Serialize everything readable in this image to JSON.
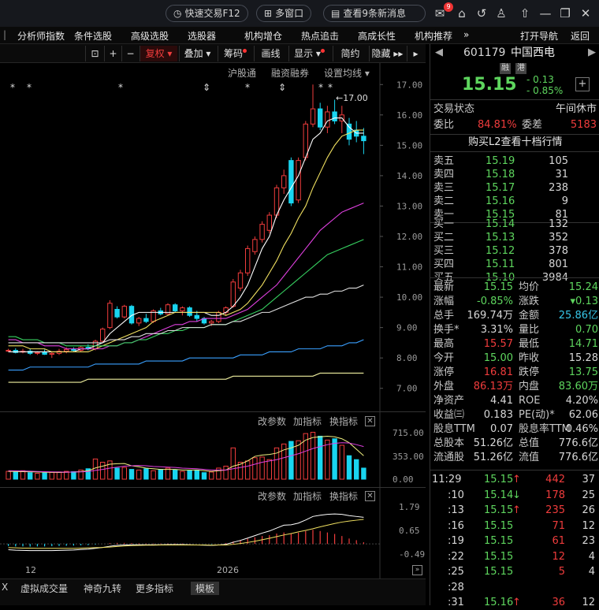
{
  "topbar": {
    "quick_trade": "快速交易F12",
    "multi_window": "多窗口",
    "news": "查看9条新消息",
    "unread": "9"
  },
  "menu": [
    "分析师指数",
    "条件选股",
    "高级选股",
    "选股器",
    "机构增仓",
    "热点追击",
    "高成长性",
    "机构推荐"
  ],
  "menu_more": "»",
  "menu_right": [
    "打开导航",
    "返回"
  ],
  "toolbar": {
    "fuquan": "复权",
    "diejia": "叠加",
    "chouma": "筹码",
    "huaxian": "画线",
    "xianshi": "显示",
    "jianyue": "简约",
    "yincang": "隐藏"
  },
  "subbar": [
    "沪股通",
    "融资融券",
    "设置均线"
  ],
  "price_axis": [
    "17.00",
    "16.00",
    "15.00",
    "14.00",
    "13.00",
    "12.00",
    "11.00",
    "10.00",
    "9.00",
    "8.00",
    "7.00"
  ],
  "high_annotation": "17.00",
  "stars": [
    "*",
    "*",
    "*",
    "⇕",
    "*",
    "⇕",
    "*",
    "*"
  ],
  "vol_pane": {
    "params": "改参数",
    "indicator": "加指标",
    "switch": "换指标",
    "close": "✕",
    "axis": [
      "715.00",
      "353.00",
      "0.00"
    ]
  },
  "macd_pane": {
    "params": "改参数",
    "indicator": "加指标",
    "switch": "换指标",
    "close": "✕",
    "axis": [
      "1.79",
      "0.65",
      "-0.49"
    ]
  },
  "x_axis": [
    "12",
    "2026"
  ],
  "bottom_tabs": [
    "X",
    "虚拟成交量",
    "神奇九转",
    "更多指标",
    "模板"
  ],
  "colors": {
    "up": "#f03c3c",
    "down": "#19d5f0",
    "ma5": "#ffffff",
    "ma10": "#f0e060",
    "ma20": "#e040e0",
    "ma30": "#36d060",
    "ma60": "#e0e0e0",
    "ma120": "#3aa0ff",
    "ma250": "#f0f0a0"
  },
  "quote": {
    "code": "601179",
    "name": "中国西电",
    "tag1": "融",
    "tag2": "港",
    "price": "15.15",
    "change": "- 0.13",
    "pct": "- 0.85%",
    "state_label": "交易状态",
    "state": "午间休市",
    "weibi_label": "委比",
    "weibi": "84.81%",
    "weicha_label": "委差",
    "weicha": "5183",
    "l2": "购买L2查看十档行情",
    "asks": [
      {
        "l": "卖五",
        "p": "15.19",
        "v": "105"
      },
      {
        "l": "卖四",
        "p": "15.18",
        "v": "31"
      },
      {
        "l": "卖三",
        "p": "15.17",
        "v": "238"
      },
      {
        "l": "卖二",
        "p": "15.16",
        "v": "9"
      },
      {
        "l": "卖一",
        "p": "15.15",
        "v": "81"
      }
    ],
    "bids": [
      {
        "l": "买一",
        "p": "15.14",
        "v": "132"
      },
      {
        "l": "买二",
        "p": "15.13",
        "v": "352"
      },
      {
        "l": "买三",
        "p": "15.12",
        "v": "378"
      },
      {
        "l": "买四",
        "p": "15.11",
        "v": "801"
      },
      {
        "l": "买五",
        "p": "15.10",
        "v": "3984"
      }
    ],
    "stats": [
      [
        "最新",
        "15.15",
        "g",
        "均价",
        "15.24",
        "g"
      ],
      [
        "涨幅",
        "-0.85%",
        "g",
        "涨跌",
        "▾0.13",
        "g"
      ],
      [
        "总手",
        "169.74万",
        "w",
        "金额",
        "25.86亿",
        "c"
      ],
      [
        "换手*",
        "3.31%",
        "w",
        "量比",
        "0.70",
        "g"
      ],
      [
        "最高",
        "15.57",
        "r",
        "最低",
        "14.71",
        "g"
      ],
      [
        "今开",
        "15.00",
        "g",
        "昨收",
        "15.28",
        "w"
      ],
      [
        "涨停",
        "16.81",
        "r",
        "跌停",
        "13.75",
        "g"
      ],
      [
        "外盘",
        "86.13万",
        "r",
        "内盘",
        "83.60万",
        "g"
      ],
      [
        "净资产",
        "4.41",
        "w",
        "ROE",
        "4.20%",
        "w"
      ],
      [
        "收益㈢",
        "0.183",
        "w",
        "PE(动)*",
        "62.06",
        "w"
      ],
      [
        "股息TTM",
        "0.07",
        "w",
        "股息率TTM",
        "0.46%",
        "w"
      ],
      [
        "总股本",
        "51.26亿",
        "w",
        "总值",
        "776.6亿",
        "w"
      ],
      [
        "流通股",
        "51.26亿",
        "w",
        "流值",
        "776.6亿",
        "w"
      ]
    ],
    "ticks": [
      [
        "11:29",
        "15.15",
        "↑",
        "442",
        "37"
      ],
      [
        ":10",
        "15.14",
        "↓",
        "178",
        "25"
      ],
      [
        ":13",
        "15.15",
        "↑",
        "235",
        "26"
      ],
      [
        ":16",
        "15.15",
        "",
        "71",
        "12"
      ],
      [
        ":19",
        "15.15",
        "",
        "61",
        "23"
      ],
      [
        ":22",
        "15.15",
        "",
        "12",
        "4"
      ],
      [
        ":25",
        "15.15",
        "",
        "5",
        "4"
      ],
      [
        ":28",
        "",
        "",
        "",
        ""
      ],
      [
        ":31",
        "15.16",
        "↑",
        "36",
        "12"
      ]
    ]
  },
  "chart_data": {
    "type": "candlestick",
    "symbol": "601179",
    "y_ticks": [
      17,
      16,
      15,
      14,
      13,
      12,
      11,
      10,
      9,
      8,
      7
    ],
    "y_range": [
      6.5,
      17.5
    ],
    "candles": [
      [
        8.25,
        8.3,
        8.2,
        8.25
      ],
      [
        8.25,
        8.32,
        8.15,
        8.18
      ],
      [
        8.2,
        8.3,
        8.15,
        8.22
      ],
      [
        8.22,
        8.3,
        8.1,
        8.15
      ],
      [
        8.15,
        8.22,
        8.1,
        8.18
      ],
      [
        8.18,
        8.28,
        8.1,
        8.12
      ],
      [
        8.12,
        8.2,
        8.0,
        8.15
      ],
      [
        8.15,
        8.3,
        8.1,
        8.22
      ],
      [
        8.22,
        8.35,
        8.15,
        8.28
      ],
      [
        8.28,
        8.35,
        8.2,
        8.25
      ],
      [
        8.25,
        8.4,
        8.2,
        8.35
      ],
      [
        8.35,
        8.45,
        8.25,
        8.3
      ],
      [
        8.3,
        8.6,
        8.25,
        8.55
      ],
      [
        8.55,
        9.0,
        8.5,
        8.95
      ],
      [
        9.0,
        9.9,
        8.95,
        9.8
      ],
      [
        9.6,
        9.7,
        9.3,
        9.35
      ],
      [
        9.35,
        9.75,
        9.3,
        9.7
      ],
      [
        9.7,
        9.75,
        9.1,
        9.15
      ],
      [
        9.15,
        9.35,
        9.05,
        9.3
      ],
      [
        9.3,
        9.45,
        9.15,
        9.2
      ],
      [
        9.2,
        9.6,
        9.15,
        9.55
      ],
      [
        9.55,
        9.65,
        9.4,
        9.45
      ],
      [
        9.45,
        9.8,
        9.4,
        9.75
      ],
      [
        9.75,
        9.8,
        9.5,
        9.55
      ],
      [
        9.55,
        9.7,
        9.4,
        9.65
      ],
      [
        9.65,
        9.7,
        9.35,
        9.4
      ],
      [
        9.4,
        9.55,
        9.2,
        9.3
      ],
      [
        9.3,
        9.35,
        9.1,
        9.15
      ],
      [
        9.15,
        9.25,
        9.05,
        9.2
      ],
      [
        9.2,
        9.55,
        9.15,
        9.5
      ],
      [
        9.5,
        9.7,
        9.4,
        9.65
      ],
      [
        9.7,
        10.6,
        9.65,
        10.5
      ],
      [
        10.3,
        10.9,
        10.2,
        10.8
      ],
      [
        10.8,
        11.7,
        10.7,
        11.6
      ],
      [
        11.5,
        12.0,
        11.4,
        11.9
      ],
      [
        11.9,
        12.5,
        11.8,
        12.4
      ],
      [
        12.2,
        12.8,
        12.1,
        12.7
      ],
      [
        12.7,
        13.7,
        12.6,
        13.6
      ],
      [
        13.6,
        14.2,
        13.4,
        14.0
      ],
      [
        14.5,
        14.6,
        13.0,
        13.1
      ],
      [
        13.2,
        14.6,
        13.1,
        14.5
      ],
      [
        14.6,
        15.8,
        14.5,
        15.7
      ],
      [
        15.7,
        17.0,
        15.6,
        16.2
      ],
      [
        16.2,
        16.4,
        15.5,
        15.6
      ],
      [
        15.6,
        16.3,
        15.4,
        16.1
      ],
      [
        16.1,
        16.5,
        15.7,
        15.8
      ],
      [
        15.8,
        16.3,
        15.4,
        16.0
      ],
      [
        15.7,
        15.9,
        15.0,
        15.2
      ],
      [
        15.5,
        15.8,
        15.1,
        15.3
      ],
      [
        15.3,
        15.57,
        14.71,
        15.15
      ]
    ],
    "ma_lines": [
      {
        "name": "MA5",
        "values": [
          8.2,
          8.2,
          8.2,
          8.2,
          8.2,
          8.2,
          8.2,
          8.2,
          8.2,
          8.2,
          8.3,
          8.3,
          8.4,
          8.5,
          8.8,
          9.0,
          9.2,
          9.4,
          9.5,
          9.5,
          9.5,
          9.5,
          9.5,
          9.5,
          9.5,
          9.5,
          9.5,
          9.5,
          9.4,
          9.4,
          9.5,
          9.7,
          10.0,
          10.4,
          11.0,
          11.6,
          12.0,
          12.7,
          13.2,
          13.6,
          14.0,
          14.6,
          15.2,
          15.4,
          15.8,
          15.9,
          15.9,
          15.6,
          15.4,
          15.4
        ]
      },
      {
        "name": "MA10",
        "values": [
          8.4,
          8.4,
          8.4,
          8.3,
          8.3,
          8.3,
          8.2,
          8.2,
          8.2,
          8.2,
          8.2,
          8.2,
          8.3,
          8.4,
          8.5,
          8.6,
          8.7,
          8.8,
          8.9,
          9.0,
          9.2,
          9.3,
          9.4,
          9.5,
          9.5,
          9.5,
          9.5,
          9.5,
          9.5,
          9.5,
          9.4,
          9.5,
          9.6,
          9.8,
          10.1,
          10.4,
          10.8,
          11.2,
          11.7,
          12.1,
          12.6,
          13.0,
          13.6,
          14.1,
          14.6,
          15.0,
          15.3,
          15.4,
          15.5,
          15.5
        ]
      },
      {
        "name": "MA20",
        "values": [
          8.6,
          8.6,
          8.5,
          8.5,
          8.5,
          8.4,
          8.4,
          8.4,
          8.3,
          8.3,
          8.3,
          8.3,
          8.3,
          8.3,
          8.4,
          8.4,
          8.5,
          8.5,
          8.6,
          8.7,
          8.8,
          8.9,
          9.0,
          9.1,
          9.1,
          9.2,
          9.2,
          9.3,
          9.3,
          9.3,
          9.3,
          9.4,
          9.5,
          9.6,
          9.8,
          10.0,
          10.2,
          10.4,
          10.7,
          11.0,
          11.3,
          11.6,
          11.9,
          12.2,
          12.4,
          12.6,
          12.8,
          12.9,
          13.0,
          13.1
        ]
      },
      {
        "name": "MA30",
        "values": [
          8.7,
          8.7,
          8.6,
          8.6,
          8.6,
          8.5,
          8.5,
          8.5,
          8.4,
          8.4,
          8.4,
          8.4,
          8.4,
          8.4,
          8.4,
          8.4,
          8.5,
          8.5,
          8.6,
          8.6,
          8.7,
          8.8,
          8.8,
          8.9,
          8.9,
          9.0,
          9.0,
          9.0,
          9.1,
          9.1,
          9.1,
          9.2,
          9.3,
          9.4,
          9.5,
          9.6,
          9.8,
          10.0,
          10.2,
          10.4,
          10.6,
          10.8,
          11.0,
          11.2,
          11.4,
          11.5,
          11.6,
          11.7,
          11.8,
          11.9
        ]
      },
      {
        "name": "MA60",
        "values": [
          8.5,
          8.5,
          8.5,
          8.5,
          8.5,
          8.5,
          8.5,
          8.5,
          8.5,
          8.5,
          8.5,
          8.5,
          8.5,
          8.5,
          8.6,
          8.6,
          8.6,
          8.7,
          8.7,
          8.8,
          8.8,
          8.8,
          8.9,
          8.9,
          9.0,
          9.0,
          9.0,
          9.0,
          9.1,
          9.1,
          9.1,
          9.2,
          9.2,
          9.3,
          9.4,
          9.5,
          9.5,
          9.6,
          9.7,
          9.8,
          9.9,
          10.0,
          10.0,
          10.1,
          10.1,
          10.2,
          10.2,
          10.3,
          10.3,
          10.4
        ]
      },
      {
        "name": "MA120",
        "values": [
          7.6,
          7.6,
          7.6,
          7.7,
          7.7,
          7.7,
          7.7,
          7.7,
          7.7,
          7.7,
          7.7,
          7.7,
          7.8,
          7.8,
          7.8,
          7.8,
          7.8,
          7.8,
          7.8,
          7.9,
          7.9,
          7.9,
          7.9,
          7.9,
          7.9,
          8.0,
          8.0,
          8.0,
          8.0,
          8.0,
          8.0,
          8.0,
          8.1,
          8.1,
          8.1,
          8.1,
          8.2,
          8.2,
          8.2,
          8.2,
          8.3,
          8.3,
          8.3,
          8.3,
          8.4,
          8.4,
          8.4,
          8.5,
          8.5,
          8.6
        ]
      },
      {
        "name": "MA250",
        "values": [
          7.2,
          7.2,
          7.2,
          7.2,
          7.2,
          7.2,
          7.2,
          7.2,
          7.2,
          7.2,
          7.2,
          7.3,
          7.3,
          7.3,
          7.3,
          7.3,
          7.3,
          7.3,
          7.3,
          7.3,
          7.3,
          7.3,
          7.3,
          7.3,
          7.3,
          7.3,
          7.3,
          7.3,
          7.3,
          7.3,
          7.3,
          7.4,
          7.4,
          7.4,
          7.4,
          7.4,
          7.4,
          7.4,
          7.4,
          7.4,
          7.4,
          7.4,
          7.4,
          7.5,
          7.5,
          7.5,
          7.5,
          7.5,
          7.5,
          7.5
        ]
      }
    ],
    "volume": {
      "y_range": [
        0,
        750
      ],
      "values": [
        120,
        110,
        130,
        100,
        90,
        95,
        105,
        110,
        120,
        115,
        140,
        160,
        310,
        260,
        280,
        170,
        180,
        150,
        140,
        160,
        130,
        150,
        170,
        140,
        120,
        130,
        140,
        100,
        110,
        170,
        200,
        480,
        260,
        280,
        330,
        340,
        300,
        480,
        540,
        580,
        590,
        700,
        720,
        660,
        600,
        620,
        520,
        360,
        300,
        170
      ]
    },
    "volume_ma": [
      {
        "name": "VOL-MA5",
        "values": [
          120,
          118,
          115,
          114,
          110,
          107,
          105,
          103,
          106,
          110,
          117,
          128,
          172,
          200,
          230,
          238,
          240,
          206,
          190,
          170,
          160,
          150,
          150,
          150,
          140,
          140,
          140,
          130,
          120,
          130,
          140,
          200,
          230,
          280,
          350,
          370,
          380,
          400,
          450,
          480,
          520,
          600,
          640,
          650,
          660,
          650,
          620,
          560,
          460,
          360
        ]
      },
      {
        "name": "VOL-MA10",
        "values": [
          130,
          128,
          125,
          122,
          118,
          115,
          112,
          110,
          108,
          110,
          112,
          118,
          135,
          150,
          170,
          185,
          200,
          205,
          210,
          205,
          195,
          190,
          185,
          180,
          170,
          165,
          160,
          150,
          140,
          140,
          140,
          160,
          180,
          200,
          230,
          260,
          280,
          300,
          330,
          360,
          390,
          430,
          470,
          500,
          530,
          550,
          560,
          555,
          530,
          500
        ]
      }
    ],
    "macd": {
      "y_range": [
        -0.6,
        1.9
      ],
      "hist": [
        -0.1,
        -0.12,
        -0.12,
        -0.13,
        -0.12,
        -0.12,
        -0.11,
        -0.1,
        -0.09,
        -0.08,
        -0.07,
        -0.06,
        -0.03,
        0.0,
        0.04,
        0.05,
        0.05,
        0.04,
        0.03,
        0.02,
        0.02,
        0.02,
        0.02,
        0.02,
        0.02,
        0.01,
        0.0,
        -0.01,
        -0.02,
        0.0,
        0.04,
        0.12,
        0.18,
        0.25,
        0.32,
        0.38,
        0.42,
        0.5,
        0.55,
        0.5,
        0.54,
        0.62,
        0.68,
        0.62,
        0.55,
        0.48,
        0.38,
        0.26,
        0.18,
        0.08
      ],
      "dif": [
        -0.28,
        -0.3,
        -0.31,
        -0.32,
        -0.32,
        -0.32,
        -0.32,
        -0.31,
        -0.3,
        -0.29,
        -0.27,
        -0.25,
        -0.21,
        -0.17,
        -0.11,
        -0.07,
        -0.05,
        -0.04,
        -0.04,
        -0.04,
        -0.04,
        -0.04,
        -0.03,
        -0.03,
        -0.03,
        -0.04,
        -0.05,
        -0.06,
        -0.07,
        -0.05,
        -0.02,
        0.08,
        0.17,
        0.28,
        0.4,
        0.52,
        0.62,
        0.76,
        0.9,
        0.92,
        1.0,
        1.15,
        1.32,
        1.38,
        1.42,
        1.44,
        1.42,
        1.36,
        1.32,
        1.28
      ],
      "dea": [
        -0.18,
        -0.19,
        -0.2,
        -0.2,
        -0.21,
        -0.21,
        -0.21,
        -0.21,
        -0.21,
        -0.21,
        -0.2,
        -0.19,
        -0.18,
        -0.17,
        -0.15,
        -0.12,
        -0.1,
        -0.08,
        -0.07,
        -0.06,
        -0.06,
        -0.05,
        -0.05,
        -0.05,
        -0.05,
        -0.05,
        -0.05,
        -0.05,
        -0.06,
        -0.05,
        -0.05,
        -0.02,
        0.02,
        0.07,
        0.13,
        0.2,
        0.27,
        0.35,
        0.43,
        0.5,
        0.58,
        0.65,
        0.73,
        0.82,
        0.9,
        0.98,
        1.05,
        1.1,
        1.14,
        1.18
      ]
    }
  }
}
